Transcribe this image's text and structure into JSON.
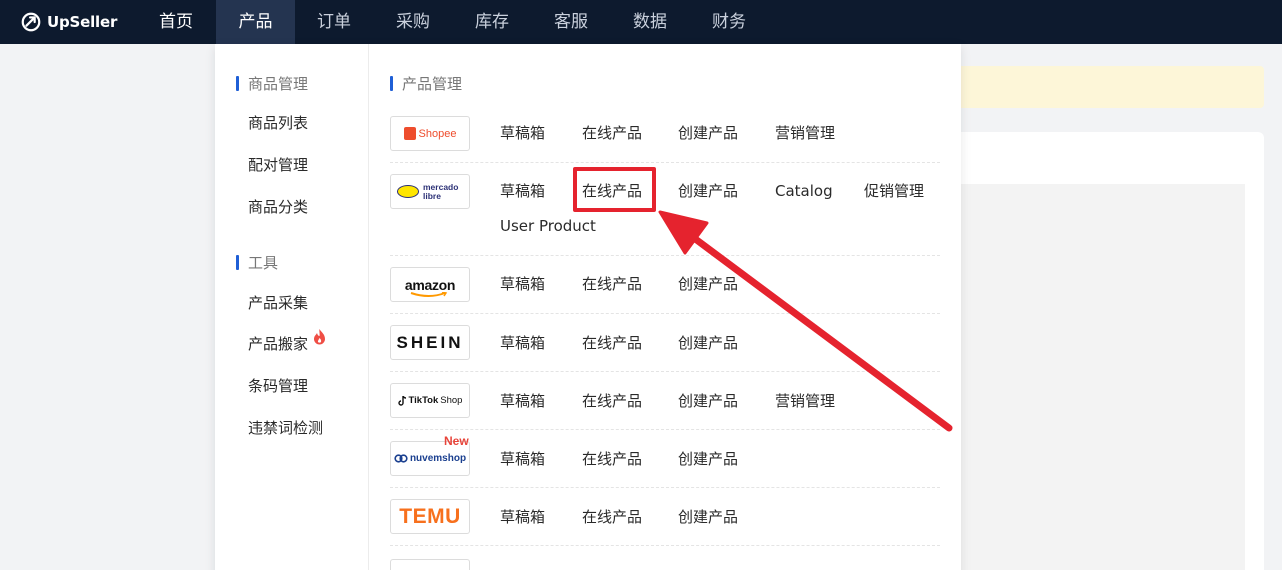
{
  "app": {
    "name": "UpSeller"
  },
  "nav": {
    "items": [
      {
        "label": "首页"
      },
      {
        "label": "产品"
      },
      {
        "label": "订单"
      },
      {
        "label": "采购"
      },
      {
        "label": "库存"
      },
      {
        "label": "客服"
      },
      {
        "label": "数据"
      },
      {
        "label": "财务"
      }
    ],
    "active": "产品"
  },
  "menu": {
    "left": {
      "section1": "商品管理",
      "items1": [
        "商品列表",
        "配对管理",
        "商品分类"
      ],
      "section2": "工具",
      "items2": [
        "产品采集",
        "产品搬家",
        "条码管理",
        "违禁词检测"
      ]
    },
    "right_title": "产品管理",
    "platforms": [
      {
        "logo": "Shopee",
        "links": [
          "草稿箱",
          "在线产品",
          "创建产品",
          "营销管理"
        ]
      },
      {
        "logo_line1": "mercado",
        "logo_line2": "libre",
        "links": [
          "草稿箱",
          "在线产品",
          "创建产品",
          "Catalog",
          "促销管理",
          "User Product"
        ]
      },
      {
        "logo": "amazon",
        "links": [
          "草稿箱",
          "在线产品",
          "创建产品"
        ]
      },
      {
        "logo": "SHEIN",
        "links": [
          "草稿箱",
          "在线产品",
          "创建产品"
        ]
      },
      {
        "logo_brand": "TikTok",
        "logo_suffix": "Shop",
        "links": [
          "草稿箱",
          "在线产品",
          "创建产品",
          "营销管理"
        ]
      },
      {
        "logo": "nuvemshop",
        "badge": "New",
        "links": [
          "草稿箱",
          "在线产品",
          "创建产品"
        ]
      },
      {
        "logo": "TEMU",
        "links": [
          "草稿箱",
          "在线产品",
          "创建产品"
        ]
      }
    ]
  },
  "colors": {
    "topbar": "#0d1a2e",
    "accent": "#1f5fd6",
    "highlight": "#e5232e",
    "shopee": "#ee4d2d",
    "temu": "#f7701d"
  }
}
